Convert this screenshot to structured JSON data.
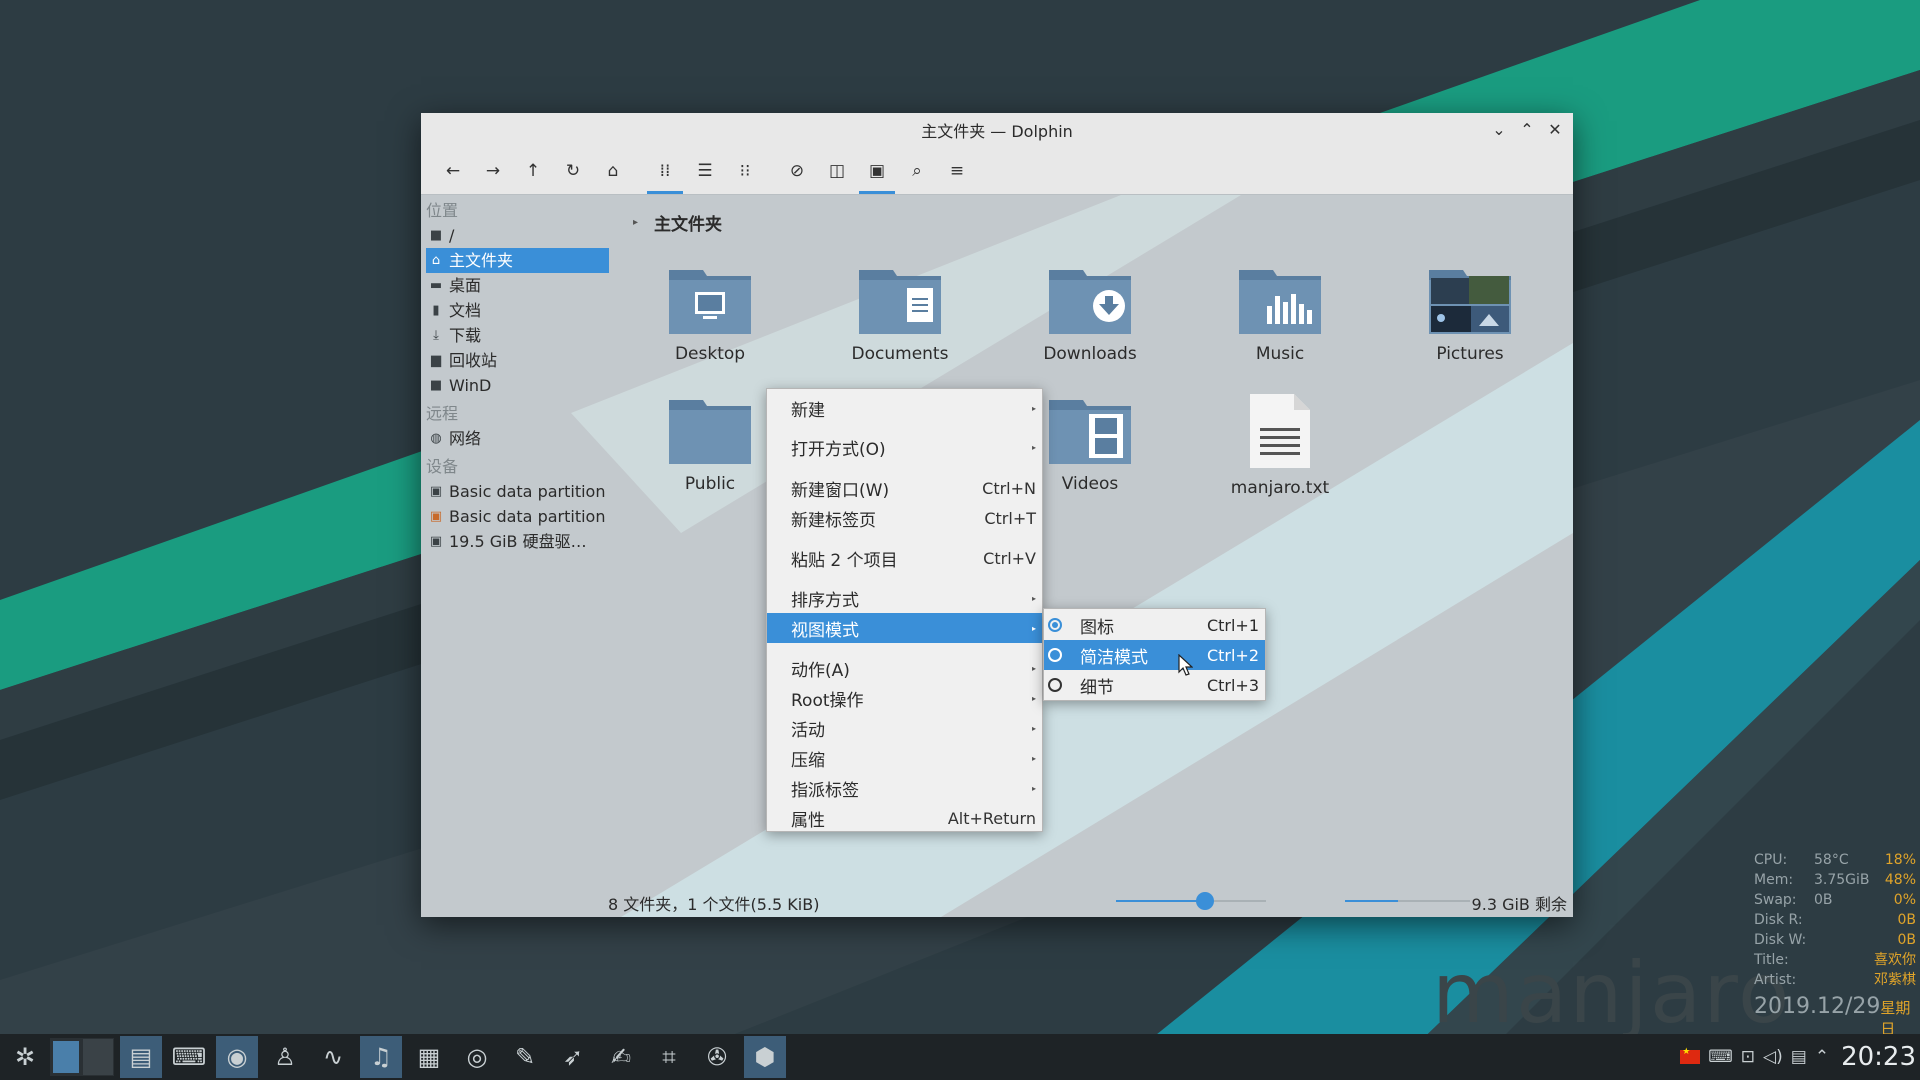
{
  "window": {
    "title": "主文件夹 — Dolphin",
    "controls": {
      "minimize": "⌄",
      "maximize": "⌃",
      "close": "✕"
    }
  },
  "toolbar": {
    "back": "←",
    "forward": "→",
    "up": "↑",
    "reload": "↻",
    "home": "⌂",
    "icons_view": "⁞⁞",
    "list_view": "☰",
    "compact_view": "⁝⁝",
    "hidden": "⊘",
    "split": "◫",
    "preview": "▣",
    "search": "⌕",
    "menu": "≡"
  },
  "sidebar": {
    "places_header": "位置",
    "places": [
      {
        "label": "/",
        "icon": "folder-icon"
      },
      {
        "label": "主文件夹",
        "icon": "home-icon"
      },
      {
        "label": "桌面",
        "icon": "desktop-icon"
      },
      {
        "label": "文档",
        "icon": "document-icon"
      },
      {
        "label": "下载",
        "icon": "download-icon"
      },
      {
        "label": "回收站",
        "icon": "trash-icon"
      },
      {
        "label": "WinD",
        "icon": "folder-icon"
      }
    ],
    "remote_header": "远程",
    "remote": [
      {
        "label": "网络",
        "icon": "network-icon"
      }
    ],
    "devices_header": "设备",
    "devices": [
      {
        "label": "Basic data partition",
        "icon": "drive-icon"
      },
      {
        "label": "Basic data partition",
        "icon": "drive-warning-icon"
      },
      {
        "label": "19.5 GiB 硬盘驱…",
        "icon": "drive-icon"
      }
    ]
  },
  "breadcrumb": {
    "current": "主文件夹"
  },
  "files": [
    {
      "name": "Desktop",
      "icon": "folder-desktop-icon"
    },
    {
      "name": "Documents",
      "icon": "folder-documents-icon"
    },
    {
      "name": "Downloads",
      "icon": "folder-downloads-icon"
    },
    {
      "name": "Music",
      "icon": "folder-music-icon"
    },
    {
      "name": "Pictures",
      "icon": "folder-pictures-icon"
    },
    {
      "name": "Public",
      "icon": "folder-public-icon"
    },
    {
      "name": "Videos",
      "icon": "folder-videos-icon"
    },
    {
      "name": "manjaro.txt",
      "icon": "text-file-icon"
    }
  ],
  "statusbar": {
    "summary": "8 文件夹，1 个文件(5.5 KiB)",
    "zoom_fraction": 0.55,
    "free_space": "9.3 GiB 剩余",
    "used_fraction": 0.42
  },
  "context_menu": {
    "items": [
      {
        "label": "新建",
        "shortcut": "",
        "submenu": true
      },
      {
        "label": "打开方式(O)",
        "shortcut": "",
        "submenu": true
      },
      {
        "label": "新建窗口(W)",
        "shortcut": "Ctrl+N",
        "submenu": false
      },
      {
        "label": "新建标签页",
        "shortcut": "Ctrl+T",
        "submenu": false
      },
      {
        "label": "粘贴 2 个项目",
        "shortcut": "Ctrl+V",
        "submenu": false
      },
      {
        "label": "排序方式",
        "shortcut": "",
        "submenu": true
      },
      {
        "label": "视图模式",
        "shortcut": "",
        "submenu": true
      },
      {
        "label": "动作(A)",
        "shortcut": "",
        "submenu": true
      },
      {
        "label": "Root操作",
        "shortcut": "",
        "submenu": true
      },
      {
        "label": "活动",
        "shortcut": "",
        "submenu": true
      },
      {
        "label": "压缩",
        "shortcut": "",
        "submenu": true
      },
      {
        "label": "指派标签",
        "shortcut": "",
        "submenu": true
      },
      {
        "label": "属性",
        "shortcut": "Alt+Return",
        "submenu": false
      }
    ],
    "arrow": "▸"
  },
  "view_submenu": {
    "items": [
      {
        "label": "图标",
        "shortcut": "Ctrl+1",
        "checked": true
      },
      {
        "label": "简洁模式",
        "shortcut": "Ctrl+2",
        "checked": false
      },
      {
        "label": "细节",
        "shortcut": "Ctrl+3",
        "checked": false
      }
    ]
  },
  "conky": {
    "rows": [
      {
        "label": "CPU:",
        "mid": "58°C",
        "value": "18%"
      },
      {
        "label": "Mem:",
        "mid": "3.75GiB",
        "value": "48%"
      },
      {
        "label": "Swap:",
        "mid": "0B",
        "value": "0%"
      },
      {
        "label": "Disk R:",
        "mid": "",
        "value": "0B"
      },
      {
        "label": "Disk W:",
        "mid": "",
        "value": "0B"
      },
      {
        "label": "Title:",
        "mid": "",
        "value": "喜欢你"
      },
      {
        "label": "Artist:",
        "mid": "",
        "value": "邓紫棋"
      }
    ],
    "date": "2019.12/29",
    "weekday": "星期日"
  },
  "brand": "manjaro",
  "taskbar": {
    "clock": "20:23",
    "launchers": [
      "file-manager-icon",
      "terminal-icon",
      "firefox-icon",
      "qq-icon",
      "system-monitor-icon",
      "music-player-icon",
      "video-player-icon",
      "eye-icon",
      "paint-icon",
      "bird-icon",
      "text-editor-icon",
      "screenshot-icon",
      "settings-wrench-icon",
      "package-icon"
    ]
  },
  "colors": {
    "accent": "#3a8fd8",
    "folder": "#5a7ea0",
    "conky_value": "#e0a42a"
  }
}
